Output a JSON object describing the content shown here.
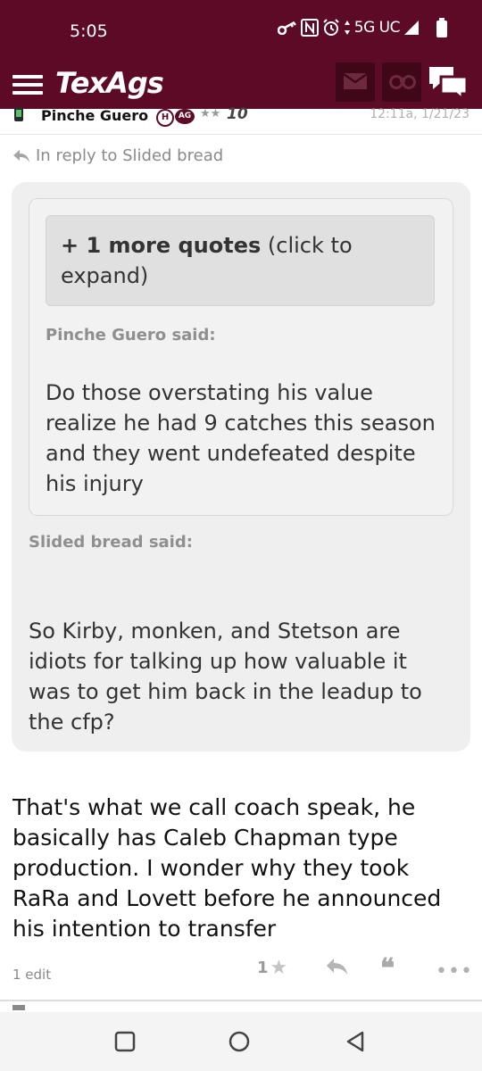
{
  "status_bar": {
    "time": "5:05",
    "network": "5G UC",
    "icons": [
      "key-icon",
      "nfc-icon",
      "alarm-icon",
      "data-arrows-icon",
      "signal-icon",
      "battery-icon"
    ]
  },
  "header": {
    "logo": "TexAgs",
    "icons": [
      "menu-icon",
      "mail-icon",
      "binoculars-icon",
      "chat-icon"
    ]
  },
  "post_author": {
    "name": "Pinche Guero",
    "badge_h": "H",
    "badge_ag": "AG",
    "stars": "★★",
    "rank": "10",
    "timestamp": "12:11a, 1/21/23"
  },
  "reply_to": "In reply to Slided bread",
  "quote": {
    "expand_bold": "+ 1 more quotes",
    "expand_rest": " (click to expand)",
    "inner_said": "Pinche Guero said:",
    "inner_text": "Do those overstating his value realize he had 9 catches this season and they went undefeated despite his injury",
    "outer_said": "Slided bread said:",
    "outer_text": "So Kirby, monken, and Stetson are idiots for talking up how valuable it was to get him back in the leadup to the cfp?"
  },
  "post_body": "That's what we call coach speak, he basically has Caleb Chapman type production. I wonder why they took RaRa and Lovett before he announced his intention to transfer",
  "post_footer": {
    "edit": "1 edit",
    "likes": "1",
    "star": "★",
    "quote_glyph": "❝",
    "more_glyph": "•••"
  },
  "nav": {
    "icons": [
      "recents-icon",
      "home-icon",
      "back-icon"
    ]
  },
  "colors": {
    "brand_maroon": "#5c0a25",
    "header_btn": "#3f0718",
    "quote_bg": "#efefef"
  }
}
